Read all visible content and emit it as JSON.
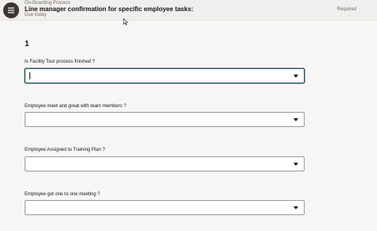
{
  "header": {
    "breadcrumb": "On-Boarding Process",
    "title": "Line manager confirmation for specific employee tasks:",
    "due": "Due today",
    "required": "Required"
  },
  "form": {
    "section_number": "1",
    "questions": [
      {
        "label": "Is Facility Tour process finished ?",
        "value": ""
      },
      {
        "label": "Employee meet and great with team members ?",
        "value": ""
      },
      {
        "label": "Employee Assigned to Training Plan ?",
        "value": ""
      },
      {
        "label": "Employee got one to one meeting ?",
        "value": ""
      }
    ]
  },
  "icons": {
    "task": "task-menu-icon",
    "dropdown": "chevron-down-icon",
    "cursor": "mouse-pointer-icon"
  },
  "colors": {
    "header_bg": "#f1efed",
    "page_bg": "#f7f6f4",
    "focus_border": "#2c5967",
    "icon_bg": "#3a3632"
  }
}
